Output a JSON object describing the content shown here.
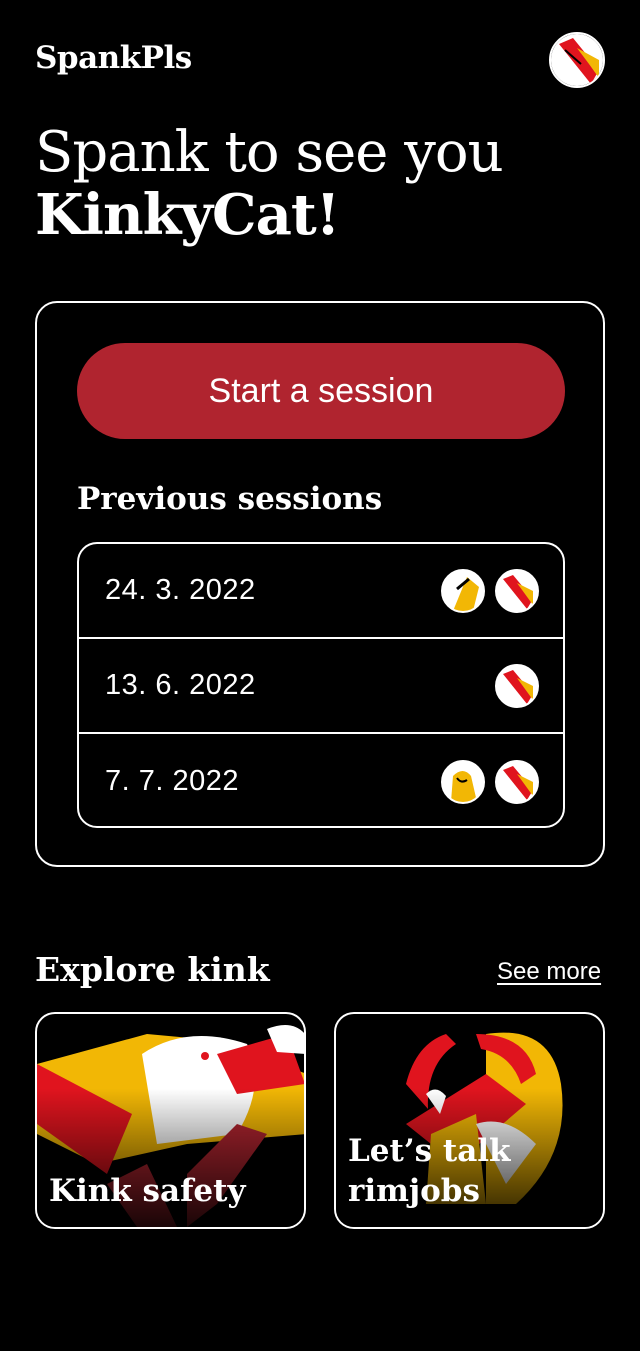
{
  "header": {
    "app_name": "SpankPls"
  },
  "greeting": {
    "line1": "Spank to see you",
    "line2": "KinkyCat!"
  },
  "session_card": {
    "start_label": "Start a session",
    "previous_title": "Previous sessions",
    "sessions": [
      {
        "date": "24. 3. 2022"
      },
      {
        "date": "13. 6. 2022"
      },
      {
        "date": "7. 7. 2022"
      }
    ]
  },
  "explore": {
    "title": "Explore kink",
    "see_more": "See more",
    "articles": [
      {
        "title": "Kink safety"
      },
      {
        "title": "Let’s talk rimjobs"
      }
    ]
  },
  "colors": {
    "accent_red": "#b0242f",
    "accent_yellow": "#f2b705",
    "bright_red": "#e0141e"
  }
}
